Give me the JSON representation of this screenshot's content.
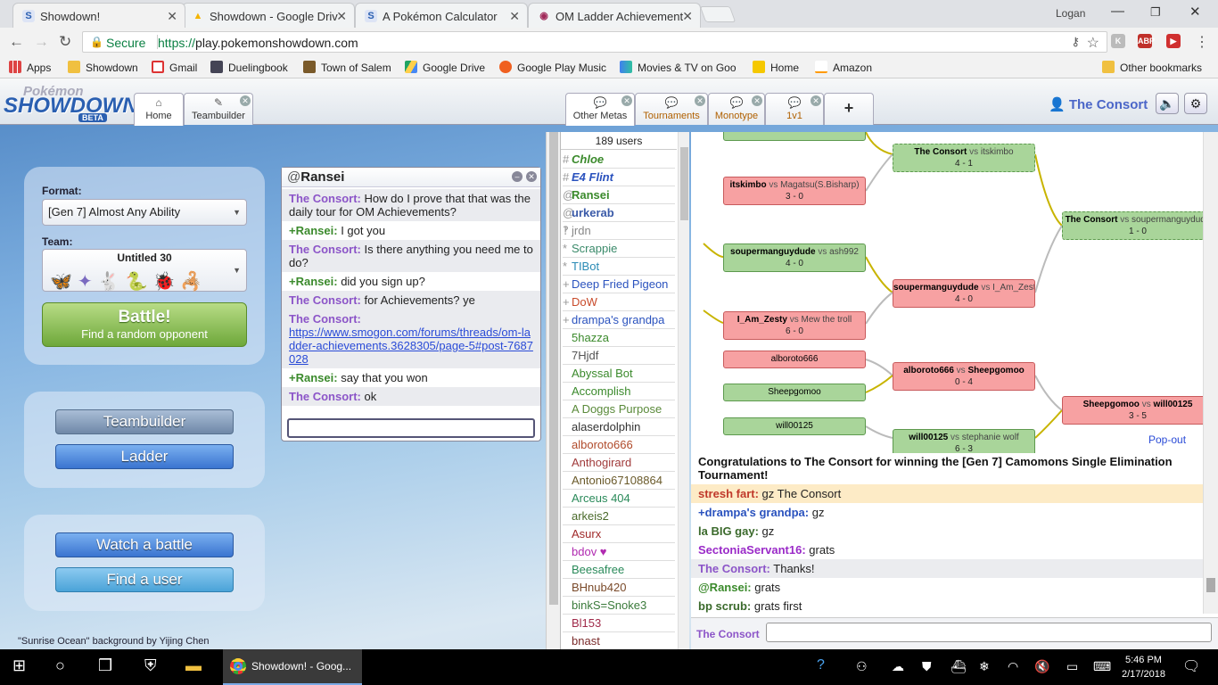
{
  "browser": {
    "tabs": [
      {
        "title": "Showdown!",
        "favicon": "S"
      },
      {
        "title": "Showdown - Google Driv",
        "favicon": "▲"
      },
      {
        "title": "A Pokémon Calculator",
        "favicon": "S"
      },
      {
        "title": "OM Ladder Achievement",
        "favicon": "◉"
      }
    ],
    "profile_name": "Logan",
    "secure_label": "Secure",
    "url_scheme": "https://",
    "url_host": "play.pokemonshowdown.com",
    "bookmarks": [
      "Apps",
      "Showdown",
      "Gmail",
      "Duelingbook",
      "Town of Salem",
      "Google Drive",
      "Google Play Music",
      "Movies & TV on Goo",
      "Home",
      "Amazon"
    ],
    "other_bookmarks": "Other bookmarks"
  },
  "header": {
    "logo_top": "Pokémon",
    "logo_main": "SHOWDOWN",
    "logo_badge": "BETA",
    "tabs": [
      {
        "label": "Home",
        "icon": "home-icon"
      },
      {
        "label": "Teambuilder",
        "icon": "pencil-icon"
      }
    ],
    "room_tabs": [
      {
        "label": "Other Metas"
      },
      {
        "label": "Tournaments"
      },
      {
        "label": "Monotype"
      },
      {
        "label": "1v1"
      }
    ],
    "add_tab": "+",
    "username": "The Consort"
  },
  "menu": {
    "format_label": "Format:",
    "format_value": "[Gen 7] Almost Any Ability",
    "team_label": "Team:",
    "team_name": "Untitled 30",
    "battle_label": "Battle!",
    "battle_sub": "Find a random opponent",
    "teambuilder": "Teambuilder",
    "ladder": "Ladder",
    "watch": "Watch a battle",
    "find_user": "Find a user",
    "credit": "\"Sunrise Ocean\" background by Yijing Chen"
  },
  "pm": {
    "group": "@",
    "title": "Ransei",
    "messages": [
      {
        "user": "The Consort:",
        "text": "How do I prove that that was the daily tour for OM Achievements?",
        "who": "cons"
      },
      {
        "user": "+Ransei:",
        "text": "I got you",
        "who": "rans"
      },
      {
        "user": "The Consort:",
        "text": "Is there anything you need me to do?",
        "who": "cons"
      },
      {
        "user": "+Ransei:",
        "text": "did you sign up?",
        "who": "rans"
      },
      {
        "user": "The Consort:",
        "text": "for Achievements? ye",
        "who": "cons"
      },
      {
        "user": "The Consort:",
        "text": "",
        "link": "https://www.smogon.com/forums/threads/om-ladder-achievements.3628305/page-5#post-7687028",
        "who": "cons"
      },
      {
        "user": "+Ransei:",
        "text": "say that you won",
        "who": "rans"
      },
      {
        "user": "The Consort:",
        "text": "ok",
        "who": "cons"
      }
    ]
  },
  "userlist": {
    "count": "189 users",
    "users": [
      {
        "g": "#",
        "n": "Chloe",
        "c": "#3b8a2c",
        "s": "bi"
      },
      {
        "g": "#",
        "n": "E4 Flint",
        "c": "#2a52be",
        "s": "bi"
      },
      {
        "g": "@",
        "n": "Ransei",
        "c": "#3b8a2c",
        "s": "b"
      },
      {
        "g": "@",
        "n": "urkerab",
        "c": "#3a5aa8",
        "s": "b"
      },
      {
        "g": "‽",
        "n": "jrdn",
        "c": "#888",
        "s": ""
      },
      {
        "g": "*",
        "n": "Scrappie",
        "c": "#3a8a6a",
        "s": ""
      },
      {
        "g": "*",
        "n": "TIBot",
        "c": "#2a8ab5",
        "s": ""
      },
      {
        "g": "+",
        "n": "Deep Fried Pigeon",
        "c": "#2a52be",
        "s": ""
      },
      {
        "g": "+",
        "n": "DoW",
        "c": "#c84a2a",
        "s": ""
      },
      {
        "g": "+",
        "n": "drampa's grandpa",
        "c": "#2a52be",
        "s": ""
      },
      {
        "g": " ",
        "n": "5hazza",
        "c": "#3b8a2c",
        "s": ""
      },
      {
        "g": " ",
        "n": "7Hjdf",
        "c": "#555",
        "s": ""
      },
      {
        "g": " ",
        "n": "Abyssal Bot",
        "c": "#3b8a2c",
        "s": ""
      },
      {
        "g": " ",
        "n": "Accomplish",
        "c": "#3b8a2c",
        "s": ""
      },
      {
        "g": " ",
        "n": "A Doggs Purpose",
        "c": "#5a8a3a",
        "s": ""
      },
      {
        "g": " ",
        "n": "alaserdolphin",
        "c": "#333",
        "s": ""
      },
      {
        "g": " ",
        "n": "alboroto666",
        "c": "#b04a2a",
        "s": ""
      },
      {
        "g": " ",
        "n": "Anthogirard",
        "c": "#a03a3a",
        "s": ""
      },
      {
        "g": " ",
        "n": "Antonio67108864",
        "c": "#6a5a2a",
        "s": ""
      },
      {
        "g": " ",
        "n": "Arceus 404",
        "c": "#2a8a5a",
        "s": ""
      },
      {
        "g": " ",
        "n": "arkeis2",
        "c": "#4a6a2a",
        "s": ""
      },
      {
        "g": " ",
        "n": "Asurx",
        "c": "#a02a2a",
        "s": ""
      },
      {
        "g": " ",
        "n": "bdov ♥",
        "c": "#b02ab0",
        "s": ""
      },
      {
        "g": " ",
        "n": "Beesafree",
        "c": "#2a8a5a",
        "s": ""
      },
      {
        "g": " ",
        "n": "BHnub420",
        "c": "#7a4a2a",
        "s": ""
      },
      {
        "g": " ",
        "n": "binkS=Snoke3",
        "c": "#3a7a3a",
        "s": ""
      },
      {
        "g": " ",
        "n": "Bl153",
        "c": "#a02a4a",
        "s": ""
      },
      {
        "g": " ",
        "n": "bnast",
        "c": "#7a2a2a",
        "s": ""
      }
    ]
  },
  "bracket": {
    "nodes": [
      {
        "w": "",
        "l": "",
        "t": "",
        "score": "",
        "cls": "win top"
      },
      {
        "w": "itskimbo",
        "l": "Magatsu(S.Bisharp)",
        "score": "3 - 0",
        "cls": "lose"
      },
      {
        "w": "The Consort",
        "l": "itskimbo",
        "score": "4 - 1",
        "cls": "win dash"
      },
      {
        "w": "The Consort",
        "l": "soupermanguydude",
        "score": "1 - 0",
        "cls": "win dash"
      },
      {
        "w": "soupermanguydude",
        "l": "ash992",
        "score": "4 - 0",
        "cls": "win"
      },
      {
        "w": "soupermanguydude",
        "l": "I_Am_Zesty",
        "score": "4 - 0",
        "cls": "lose"
      },
      {
        "w": "I_Am_Zesty",
        "l": "Mew the troll",
        "score": "6 - 0",
        "cls": "lose"
      },
      {
        "w": "alboroto666",
        "l": "",
        "score": "",
        "cls": "lose single"
      },
      {
        "w": "alboroto666",
        "l": "Sheepgomoo",
        "score": "0 - 4",
        "cls": "lose",
        "boldLoser": true
      },
      {
        "w": "Sheepgomoo",
        "l": "",
        "score": "",
        "cls": "win single"
      },
      {
        "w": "Sheepgomoo",
        "l": "will00125",
        "score": "3 - 5",
        "cls": "lose",
        "boldLoser": true
      },
      {
        "w": "will00125",
        "l": "",
        "score": "",
        "cls": "win single"
      },
      {
        "w": "will00125",
        "l": "stephanie wolf",
        "score": "6 - 3",
        "cls": "win"
      }
    ],
    "vs": "vs",
    "popout": "Pop-out"
  },
  "room": {
    "announcement": "Congratulations to The Consort for winning the [Gen 7] Camomons Single Elimination Tournament!",
    "messages": [
      {
        "user": "stresh fart:",
        "text": "gz The Consort",
        "color": "#c0392b",
        "cls": "hl"
      },
      {
        "user": "+drampa's grandpa:",
        "text": "gz",
        "color": "#2a52be",
        "cls": ""
      },
      {
        "user": "la BIG gay:",
        "text": "gz",
        "color": "#3b6a2c",
        "cls": ""
      },
      {
        "user": "SectoniaServant16:",
        "text": "grats",
        "color": "#9a2ac8",
        "cls": ""
      },
      {
        "user": "The Consort:",
        "text": "Thanks!",
        "color": "#8c55c8",
        "cls": "alt"
      },
      {
        "user": "@Ransei:",
        "text": "grats",
        "color": "#3b8a2c",
        "cls": ""
      },
      {
        "user": "bp scrub:",
        "text": "grats first",
        "color": "#3b6a2c",
        "cls": ""
      }
    ],
    "input_name": "The Consort"
  },
  "taskbar": {
    "app_title": "Showdown! - Goog...",
    "time": "5:46 PM",
    "date": "2/17/2018"
  }
}
